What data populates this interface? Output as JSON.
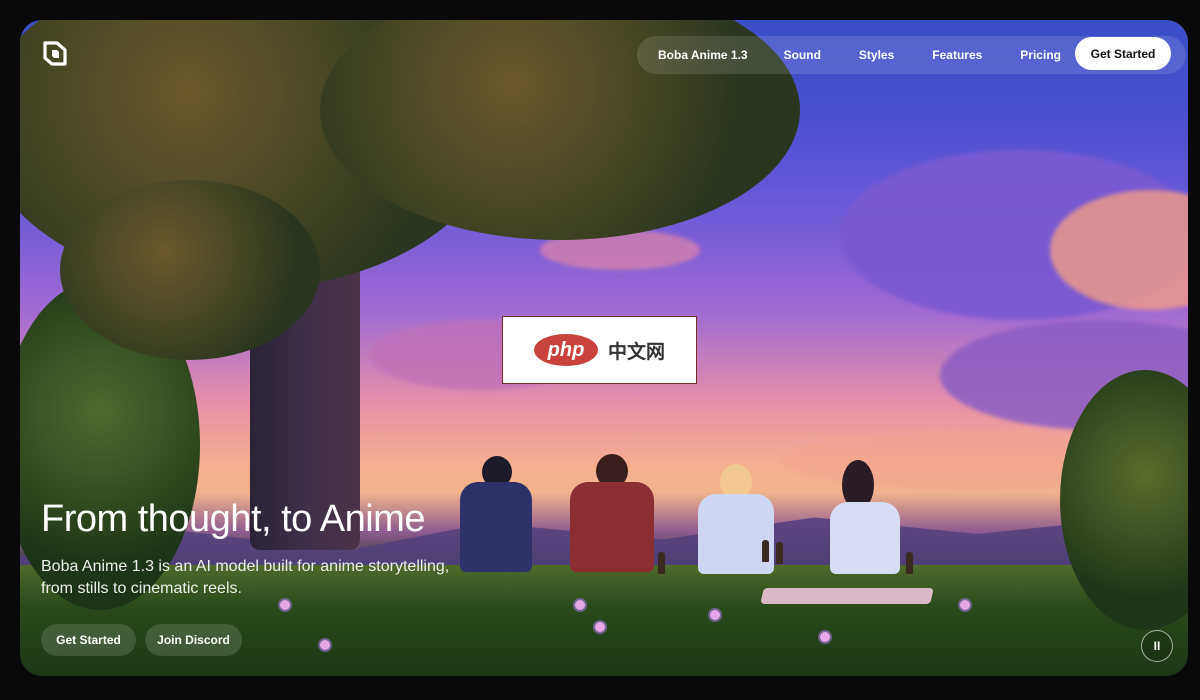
{
  "nav": {
    "logo_icon": "boba-logo-icon",
    "items": [
      "Boba Anime 1.3",
      "Sound",
      "Styles",
      "Features",
      "Pricing"
    ],
    "cta_label": "Get Started"
  },
  "watermark": {
    "brand": "php",
    "text": "中文网"
  },
  "hero": {
    "title": "From thought, to Anime",
    "subtitle": "Boba Anime 1.3 is an AI model built for anime storytelling, from stills to cinematic reels.",
    "primary_button": "Get Started",
    "secondary_button": "Join Discord"
  },
  "controls": {
    "pause_icon": "pause-icon",
    "pause_glyph": "II"
  }
}
